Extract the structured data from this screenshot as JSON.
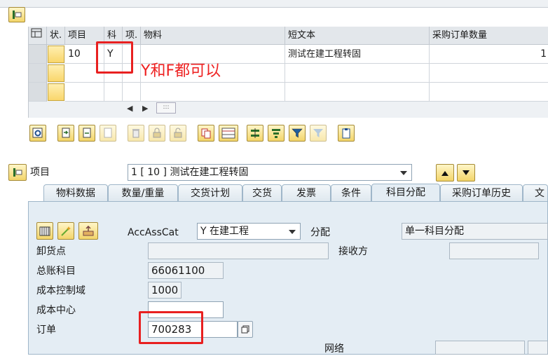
{
  "table": {
    "headers": [
      "状.",
      "项目",
      "科",
      "项.",
      "物料",
      "短文本",
      "采购订单数量"
    ],
    "row": {
      "status": "",
      "item": "10",
      "acct_cat": "Y",
      "item_cat": "",
      "material": "",
      "short_text": "测试在建工程转固",
      "qty": "1"
    }
  },
  "annotation": {
    "text": "Y和F都可以"
  },
  "item_selector": {
    "label": "项目",
    "value": "1 [ 10 ] 测试在建工程转固"
  },
  "tabs": [
    "物料数据",
    "数量/重量",
    "交货计划",
    "交货",
    "发票",
    "条件",
    "科目分配",
    "采购订单历史",
    "文本"
  ],
  "active_tab": "科目分配",
  "account_assignment": {
    "acc_ass_cat_label": "AccAssCat",
    "acc_ass_cat_value": "Y 在建工程",
    "distribution_label": "分配",
    "distribution_value": "单一科目分配",
    "unloading_point_label": "卸货点",
    "unloading_point_value": "",
    "recipient_label": "接收方",
    "recipient_value": "",
    "gl_account_label": "总账科目",
    "gl_account_value": "66061100",
    "co_area_label": "成本控制域",
    "co_area_value": "1000",
    "cost_center_label": "成本中心",
    "cost_center_value": "",
    "order_label": "订单",
    "order_value": "700283",
    "network_label": "网络"
  },
  "colors": {
    "annotation_red": "#e82020",
    "tab_blue": "#9fb6c9",
    "button_yellow": "#f3d56a"
  }
}
